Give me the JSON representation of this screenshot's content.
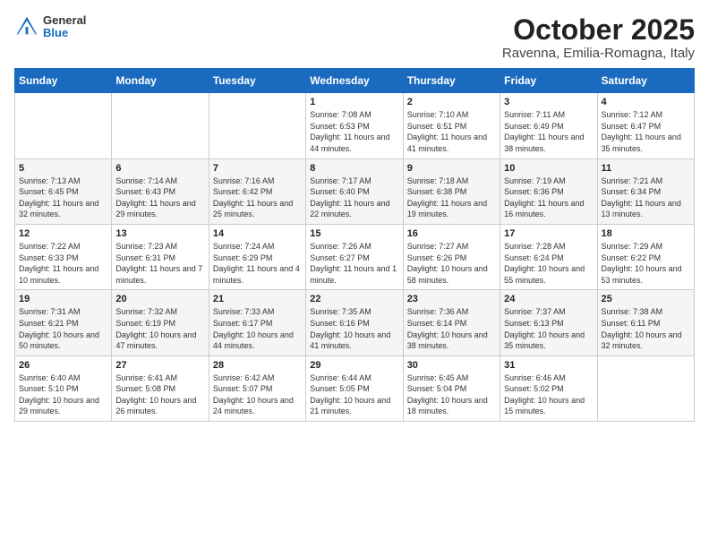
{
  "logo": {
    "general": "General",
    "blue": "Blue"
  },
  "header": {
    "month": "October 2025",
    "location": "Ravenna, Emilia-Romagna, Italy"
  },
  "weekdays": [
    "Sunday",
    "Monday",
    "Tuesday",
    "Wednesday",
    "Thursday",
    "Friday",
    "Saturday"
  ],
  "weeks": [
    [
      {
        "day": "",
        "info": ""
      },
      {
        "day": "",
        "info": ""
      },
      {
        "day": "",
        "info": ""
      },
      {
        "day": "1",
        "info": "Sunrise: 7:08 AM\nSunset: 6:53 PM\nDaylight: 11 hours and 44 minutes."
      },
      {
        "day": "2",
        "info": "Sunrise: 7:10 AM\nSunset: 6:51 PM\nDaylight: 11 hours and 41 minutes."
      },
      {
        "day": "3",
        "info": "Sunrise: 7:11 AM\nSunset: 6:49 PM\nDaylight: 11 hours and 38 minutes."
      },
      {
        "day": "4",
        "info": "Sunrise: 7:12 AM\nSunset: 6:47 PM\nDaylight: 11 hours and 35 minutes."
      }
    ],
    [
      {
        "day": "5",
        "info": "Sunrise: 7:13 AM\nSunset: 6:45 PM\nDaylight: 11 hours and 32 minutes."
      },
      {
        "day": "6",
        "info": "Sunrise: 7:14 AM\nSunset: 6:43 PM\nDaylight: 11 hours and 29 minutes."
      },
      {
        "day": "7",
        "info": "Sunrise: 7:16 AM\nSunset: 6:42 PM\nDaylight: 11 hours and 25 minutes."
      },
      {
        "day": "8",
        "info": "Sunrise: 7:17 AM\nSunset: 6:40 PM\nDaylight: 11 hours and 22 minutes."
      },
      {
        "day": "9",
        "info": "Sunrise: 7:18 AM\nSunset: 6:38 PM\nDaylight: 11 hours and 19 minutes."
      },
      {
        "day": "10",
        "info": "Sunrise: 7:19 AM\nSunset: 6:36 PM\nDaylight: 11 hours and 16 minutes."
      },
      {
        "day": "11",
        "info": "Sunrise: 7:21 AM\nSunset: 6:34 PM\nDaylight: 11 hours and 13 minutes."
      }
    ],
    [
      {
        "day": "12",
        "info": "Sunrise: 7:22 AM\nSunset: 6:33 PM\nDaylight: 11 hours and 10 minutes."
      },
      {
        "day": "13",
        "info": "Sunrise: 7:23 AM\nSunset: 6:31 PM\nDaylight: 11 hours and 7 minutes."
      },
      {
        "day": "14",
        "info": "Sunrise: 7:24 AM\nSunset: 6:29 PM\nDaylight: 11 hours and 4 minutes."
      },
      {
        "day": "15",
        "info": "Sunrise: 7:26 AM\nSunset: 6:27 PM\nDaylight: 11 hours and 1 minute."
      },
      {
        "day": "16",
        "info": "Sunrise: 7:27 AM\nSunset: 6:26 PM\nDaylight: 10 hours and 58 minutes."
      },
      {
        "day": "17",
        "info": "Sunrise: 7:28 AM\nSunset: 6:24 PM\nDaylight: 10 hours and 55 minutes."
      },
      {
        "day": "18",
        "info": "Sunrise: 7:29 AM\nSunset: 6:22 PM\nDaylight: 10 hours and 53 minutes."
      }
    ],
    [
      {
        "day": "19",
        "info": "Sunrise: 7:31 AM\nSunset: 6:21 PM\nDaylight: 10 hours and 50 minutes."
      },
      {
        "day": "20",
        "info": "Sunrise: 7:32 AM\nSunset: 6:19 PM\nDaylight: 10 hours and 47 minutes."
      },
      {
        "day": "21",
        "info": "Sunrise: 7:33 AM\nSunset: 6:17 PM\nDaylight: 10 hours and 44 minutes."
      },
      {
        "day": "22",
        "info": "Sunrise: 7:35 AM\nSunset: 6:16 PM\nDaylight: 10 hours and 41 minutes."
      },
      {
        "day": "23",
        "info": "Sunrise: 7:36 AM\nSunset: 6:14 PM\nDaylight: 10 hours and 38 minutes."
      },
      {
        "day": "24",
        "info": "Sunrise: 7:37 AM\nSunset: 6:13 PM\nDaylight: 10 hours and 35 minutes."
      },
      {
        "day": "25",
        "info": "Sunrise: 7:38 AM\nSunset: 6:11 PM\nDaylight: 10 hours and 32 minutes."
      }
    ],
    [
      {
        "day": "26",
        "info": "Sunrise: 6:40 AM\nSunset: 5:10 PM\nDaylight: 10 hours and 29 minutes."
      },
      {
        "day": "27",
        "info": "Sunrise: 6:41 AM\nSunset: 5:08 PM\nDaylight: 10 hours and 26 minutes."
      },
      {
        "day": "28",
        "info": "Sunrise: 6:42 AM\nSunset: 5:07 PM\nDaylight: 10 hours and 24 minutes."
      },
      {
        "day": "29",
        "info": "Sunrise: 6:44 AM\nSunset: 5:05 PM\nDaylight: 10 hours and 21 minutes."
      },
      {
        "day": "30",
        "info": "Sunrise: 6:45 AM\nSunset: 5:04 PM\nDaylight: 10 hours and 18 minutes."
      },
      {
        "day": "31",
        "info": "Sunrise: 6:46 AM\nSunset: 5:02 PM\nDaylight: 10 hours and 15 minutes."
      },
      {
        "day": "",
        "info": ""
      }
    ]
  ]
}
